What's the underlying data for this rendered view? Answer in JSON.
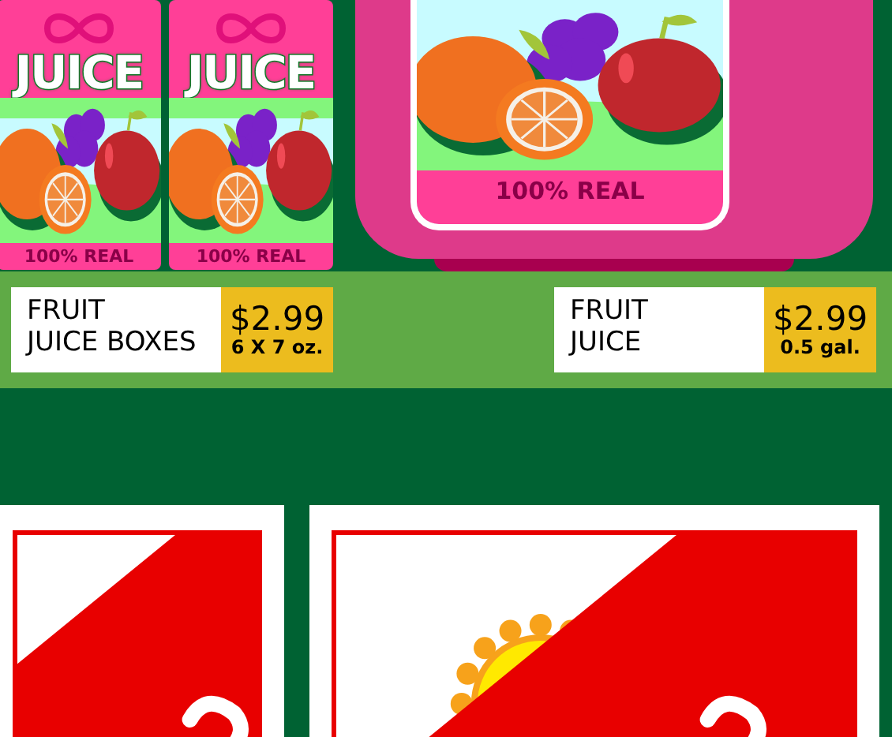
{
  "shelf_items": [
    {
      "kind": "juice-box",
      "brand": "JUICE",
      "tagline": "100% REAL"
    },
    {
      "kind": "juice-box",
      "brand": "JUICE",
      "tagline": "100% REAL"
    },
    {
      "kind": "jug",
      "tagline": "100% REAL"
    }
  ],
  "price_tags": [
    {
      "name": "FRUIT\nJUICE BOXES",
      "price": "$2.99",
      "size": "6 X 7 oz."
    },
    {
      "name": "FRUIT\nJUICE",
      "price": "$2.99",
      "size": "0.5 gal."
    }
  ]
}
